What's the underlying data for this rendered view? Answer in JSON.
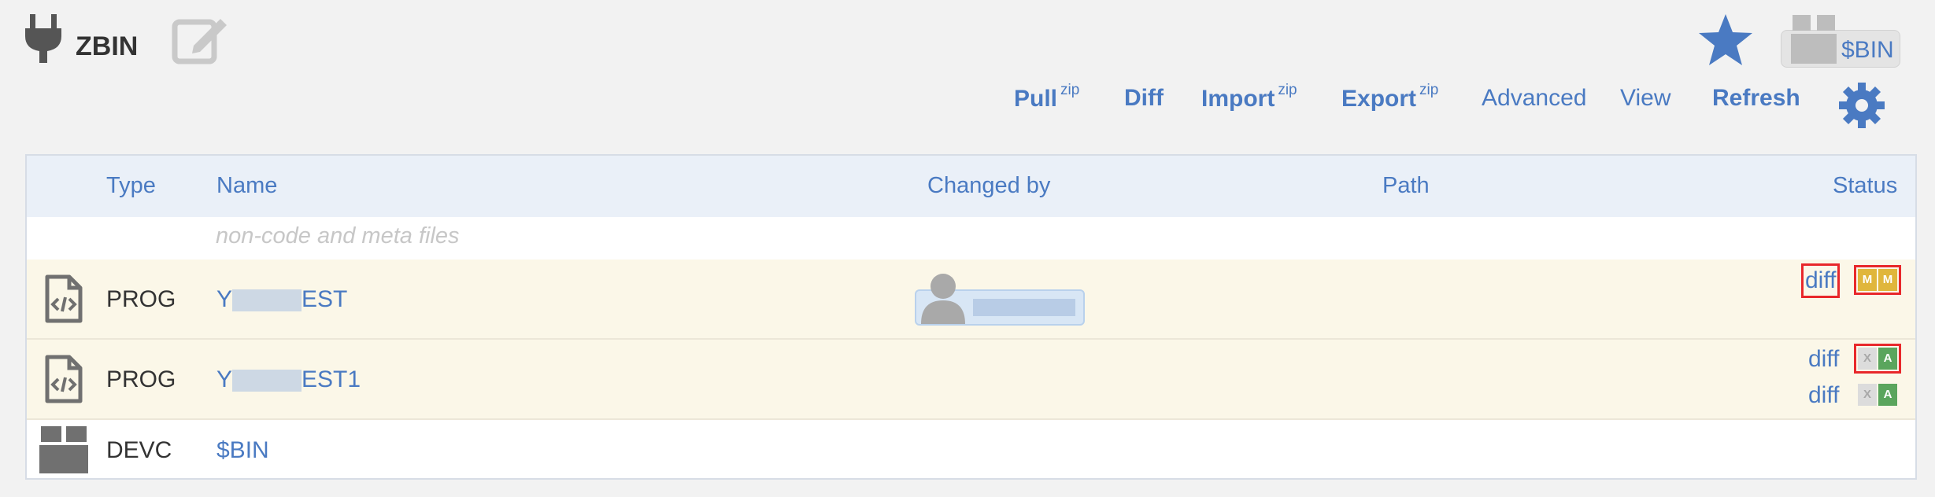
{
  "header": {
    "repo_name": "ZBIN",
    "package_label": "$BIN"
  },
  "toolbar": {
    "pull": "Pull",
    "pull_sup": "zip",
    "diff": "Diff",
    "import": "Import",
    "import_sup": "zip",
    "export": "Export",
    "export_sup": "zip",
    "advanced": "Advanced",
    "view": "View",
    "refresh": "Refresh"
  },
  "table": {
    "columns": {
      "type": "Type",
      "name": "Name",
      "changed_by": "Changed by",
      "path": "Path",
      "status": "Status"
    },
    "meta_row": "non-code and meta files",
    "rows": [
      {
        "type": "PROG",
        "name_prefix": "Y",
        "name_suffix": "EST",
        "diffs": [
          "diff"
        ],
        "badges": [
          [
            "M",
            "M"
          ]
        ]
      },
      {
        "type": "PROG",
        "name_prefix": "Y",
        "name_suffix": "EST1",
        "diffs": [
          "diff",
          "diff"
        ],
        "badges": [
          [
            "X",
            "A"
          ],
          [
            "X",
            "A"
          ]
        ]
      },
      {
        "type": "DEVC",
        "name": "$BIN"
      }
    ]
  },
  "colors": {
    "link": "#4a7ac2",
    "header_bg": "#eaf0f8",
    "modified_row_bg": "#fbf7e8",
    "badge_modified": "#e0b63c",
    "badge_added": "#5aa55d",
    "highlight": "#e8282b"
  }
}
